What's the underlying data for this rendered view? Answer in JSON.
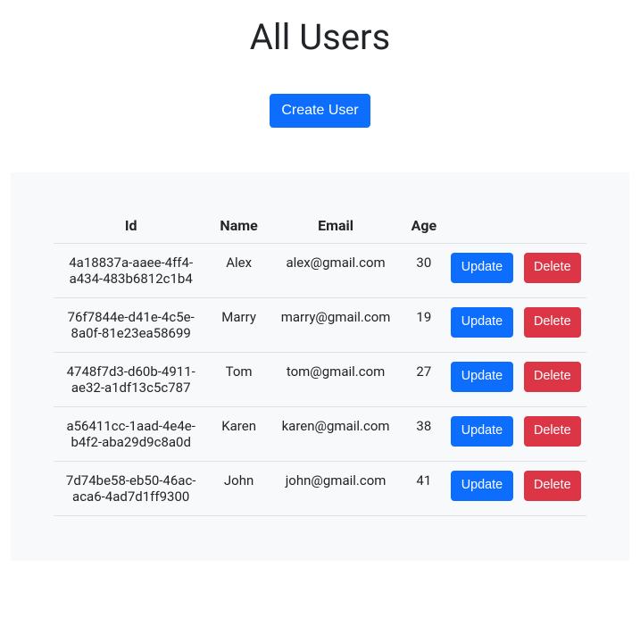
{
  "page": {
    "title": "All Users",
    "create_label": "Create User"
  },
  "table": {
    "headers": {
      "id": "Id",
      "name": "Name",
      "email": "Email",
      "age": "Age"
    },
    "update_label": "Update",
    "delete_label": "Delete",
    "rows": [
      {
        "id": "4a18837a-aaee-4ff4-a434-483b6812c1b4",
        "name": "Alex",
        "email": "alex@gmail.com",
        "age": "30"
      },
      {
        "id": "76f7844e-d41e-4c5e-8a0f-81e23ea58699",
        "name": "Marry",
        "email": "marry@gmail.com",
        "age": "19"
      },
      {
        "id": "4748f7d3-d60b-4911-ae32-a1df13c5c787",
        "name": "Tom",
        "email": "tom@gmail.com",
        "age": "27"
      },
      {
        "id": "a56411cc-1aad-4e4e-b4f2-aba29d9c8a0d",
        "name": "Karen",
        "email": "karen@gmail.com",
        "age": "38"
      },
      {
        "id": "7d74be58-eb50-46ac-aca6-4ad7d1ff9300",
        "name": "John",
        "email": "john@gmail.com",
        "age": "41"
      }
    ]
  }
}
